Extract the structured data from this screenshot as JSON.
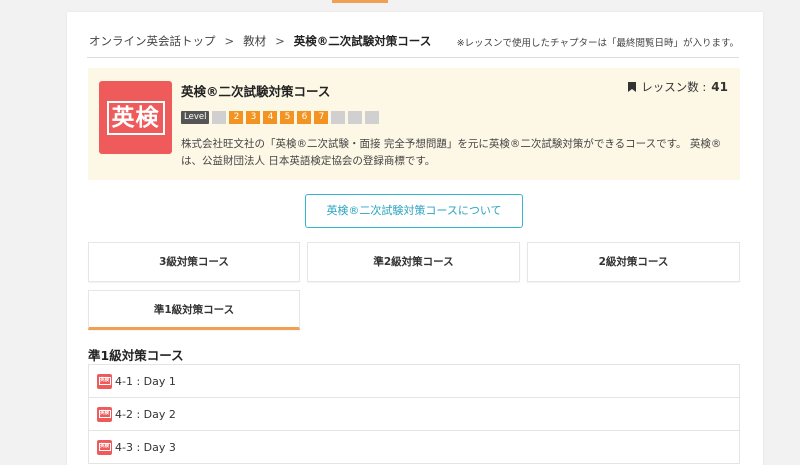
{
  "breadcrumb": {
    "home": "オンライン英会話トップ",
    "materials": "教材",
    "current": "英検®二次試験対策コース",
    "separator": ">",
    "note": "※レッスンで使用したチャプターは「最終閲覧日時」が入ります。"
  },
  "course": {
    "logo_text": "英検",
    "title": "英検®二次試験対策コース",
    "lesson_count_label": "レッスン数 :",
    "lesson_count": "41",
    "level_label": "Level",
    "levels": [
      {
        "label": "",
        "active": false
      },
      {
        "label": "2",
        "active": true
      },
      {
        "label": "3",
        "active": true
      },
      {
        "label": "4",
        "active": true
      },
      {
        "label": "5",
        "active": true
      },
      {
        "label": "6",
        "active": true
      },
      {
        "label": "7",
        "active": true
      },
      {
        "label": "",
        "active": false
      },
      {
        "label": "",
        "active": false
      },
      {
        "label": "",
        "active": false
      }
    ],
    "description": "株式会社旺文社の「英検®二次試験・面接 完全予想問題」を元に英検®二次試験対策ができるコースです。 英検®は、公益財団法人 日本英語検定協会の登録商標です。"
  },
  "about_button": "英検®二次試験対策コースについて",
  "tabs": [
    {
      "label": "3級対策コース",
      "active": false
    },
    {
      "label": "準2級対策コース",
      "active": false
    },
    {
      "label": "2級対策コース",
      "active": false
    },
    {
      "label": "準1級対策コース",
      "active": true
    }
  ],
  "section_heading": "準1級対策コース",
  "chapters": [
    {
      "label": "4-1 : Day 1"
    },
    {
      "label": "4-2 : Day 2"
    },
    {
      "label": "4-3 : Day 3"
    }
  ],
  "colors": {
    "accent": "#f0a050",
    "logo_red": "#ef5b5b",
    "level_active": "#f39322",
    "level_inactive": "#d0d0d0",
    "button_border": "#35b6cf",
    "course_box_bg": "#fdf8e6"
  },
  "icons": {
    "bookmark": "bookmark-icon",
    "course_logo": "eiken-logo-icon"
  }
}
